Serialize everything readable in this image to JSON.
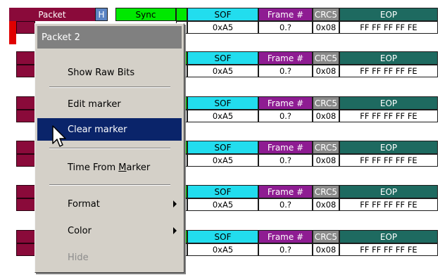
{
  "header_row": {
    "packet_label": "Packet",
    "h_label": "H",
    "sync_label": "Sync"
  },
  "columns": {
    "sof": "SOF",
    "frame": "Frame #",
    "crc5": "CRC5",
    "eop": "EOP"
  },
  "rows": [
    {
      "sof": "0xA5",
      "frame": "0.?",
      "crc5": "0x08",
      "eop": "FF FF FF FF FE"
    },
    {
      "sof": "0xA5",
      "frame": "0.?",
      "crc5": "0x08",
      "eop": "FF FF FF FF FE"
    },
    {
      "sof": "0xA5",
      "frame": "0.?",
      "crc5": "0x08",
      "eop": "FF FF FF FF FE"
    },
    {
      "sof": "0xA5",
      "frame": "0.?",
      "crc5": "0x08",
      "eop": "FF FF FF FF FE"
    },
    {
      "sof": "0xA5",
      "frame": "0.?",
      "crc5": "0x08",
      "eop": "FF FF FF FF FE"
    },
    {
      "sof": "0xA5",
      "frame": "0.?",
      "crc5": "0x08",
      "eop": "FF FF FF FF FE"
    }
  ],
  "context_menu": {
    "title": "Packet 2",
    "show_raw_bits": "Show Raw Bits",
    "edit_marker": "Edit marker",
    "clear_marker": "Clear marker",
    "time_from_marker_pre": "Time From ",
    "time_from_marker_key": "M",
    "time_from_marker_post": "arker",
    "format": "Format",
    "color": "Color",
    "hide": "Hide"
  },
  "colors": {
    "packet": "#8a0a3a",
    "sync": "#00e800",
    "sof": "#22ddee",
    "frame": "#8e1c92",
    "crc5": "#8a8a8a",
    "eop": "#1e6a60",
    "h_box": "#5b84c4",
    "menu_bg": "#d4d0c8",
    "menu_selected": "#0a246a"
  }
}
